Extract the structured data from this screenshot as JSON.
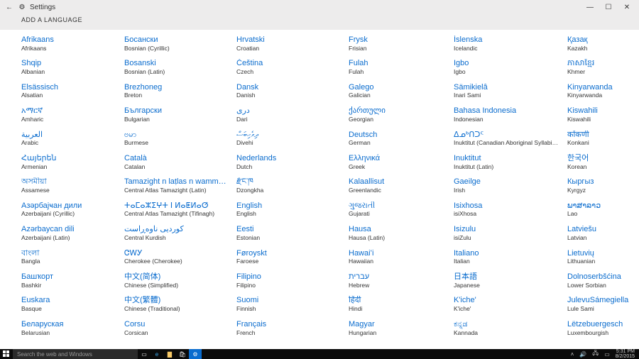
{
  "window": {
    "title": "Settings",
    "back_icon": "←",
    "gear_icon": "⚙",
    "minimize": "—",
    "maximize": "☐",
    "close": "✕"
  },
  "header": "ADD A LANGUAGE",
  "columns": [
    [
      {
        "n": "Afrikaans",
        "e": "Afrikaans"
      },
      {
        "n": "Shqip",
        "e": "Albanian"
      },
      {
        "n": "Elsässisch",
        "e": "Alsatian"
      },
      {
        "n": "አማርኛ",
        "e": "Amharic"
      },
      {
        "n": "العربية",
        "e": "Arabic"
      },
      {
        "n": "Հայերեն",
        "e": "Armenian"
      },
      {
        "n": "অসমীয়া",
        "e": "Assamese"
      },
      {
        "n": "Азәрбајҹан дили",
        "e": "Azerbaijani (Cyrillic)"
      },
      {
        "n": "Azərbaycan dili",
        "e": "Azerbaijani (Latin)"
      },
      {
        "n": "বাংলা",
        "e": "Bangla"
      },
      {
        "n": "Башҡорт",
        "e": "Bashkir"
      },
      {
        "n": "Euskara",
        "e": "Basque"
      },
      {
        "n": "Беларуская",
        "e": "Belarusian"
      }
    ],
    [
      {
        "n": "Босански",
        "e": "Bosnian (Cyrillic)"
      },
      {
        "n": "Bosanski",
        "e": "Bosnian (Latin)"
      },
      {
        "n": "Brezhoneg",
        "e": "Breton"
      },
      {
        "n": "Български",
        "e": "Bulgarian"
      },
      {
        "n": "ဗမာ",
        "e": "Burmese"
      },
      {
        "n": "Català",
        "e": "Catalan"
      },
      {
        "n": "Tamazight n laṭlas n wamm…",
        "e": "Central Atlas Tamazight (Latin)"
      },
      {
        "n": "ⵜⴰⵎⴰⵣⵉⵖⵜ ⵏ ⵍⴰⵟⵍⴰⵚ",
        "e": "Central Atlas Tamazight (Tifinagh)"
      },
      {
        "n": "کوردیی ناوەڕاست",
        "e": "Central Kurdish"
      },
      {
        "n": "ᏣᎳᎩ",
        "e": "Cherokee (Cherokee)"
      },
      {
        "n": "中文(简体)",
        "e": "Chinese (Simplified)"
      },
      {
        "n": "中文(繁體)",
        "e": "Chinese (Traditional)"
      },
      {
        "n": "Corsu",
        "e": "Corsican"
      }
    ],
    [
      {
        "n": "Hrvatski",
        "e": "Croatian"
      },
      {
        "n": "Čeština",
        "e": "Czech"
      },
      {
        "n": "Dansk",
        "e": "Danish"
      },
      {
        "n": "درى",
        "e": "Dari"
      },
      {
        "n": "ދިވެހިބަސް",
        "e": "Divehi"
      },
      {
        "n": "Nederlands",
        "e": "Dutch"
      },
      {
        "n": "རྫོང་ཁ",
        "e": "Dzongkha"
      },
      {
        "n": "English",
        "e": "English"
      },
      {
        "n": "Eesti",
        "e": "Estonian"
      },
      {
        "n": "Føroyskt",
        "e": "Faroese"
      },
      {
        "n": "Filipino",
        "e": "Filipino"
      },
      {
        "n": "Suomi",
        "e": "Finnish"
      },
      {
        "n": "Français",
        "e": "French"
      }
    ],
    [
      {
        "n": "Frysk",
        "e": "Frisian"
      },
      {
        "n": "Fulah",
        "e": "Fulah"
      },
      {
        "n": "Galego",
        "e": "Galician"
      },
      {
        "n": "ქართული",
        "e": "Georgian"
      },
      {
        "n": "Deutsch",
        "e": "German"
      },
      {
        "n": "Ελληνικά",
        "e": "Greek"
      },
      {
        "n": "Kalaallisut",
        "e": "Greenlandic"
      },
      {
        "n": "ગુજરાતી",
        "e": "Gujarati"
      },
      {
        "n": "Hausa",
        "e": "Hausa (Latin)"
      },
      {
        "n": "Hawaiʻi",
        "e": "Hawaiian"
      },
      {
        "n": "עברית",
        "e": "Hebrew"
      },
      {
        "n": "हिंदी",
        "e": "Hindi"
      },
      {
        "n": "Magyar",
        "e": "Hungarian"
      }
    ],
    [
      {
        "n": "Íslenska",
        "e": "Icelandic"
      },
      {
        "n": "Igbo",
        "e": "Igbo"
      },
      {
        "n": "Sämikielâ",
        "e": "Inari Sami"
      },
      {
        "n": "Bahasa Indonesia",
        "e": "Indonesian"
      },
      {
        "n": "ᐃᓄᒃᑎᑐᑦ",
        "e": "Inuktitut (Canadian Aboriginal Syllabics)"
      },
      {
        "n": "Inuktitut",
        "e": "Inuktitut (Latin)"
      },
      {
        "n": "Gaeilge",
        "e": "Irish"
      },
      {
        "n": "Isixhosa",
        "e": "isiXhosa"
      },
      {
        "n": "Isizulu",
        "e": "isiZulu"
      },
      {
        "n": "Italiano",
        "e": "Italian"
      },
      {
        "n": "日本語",
        "e": "Japanese"
      },
      {
        "n": "K'iche'",
        "e": "K'iche'"
      },
      {
        "n": "ಕನ್ನಡ",
        "e": "Kannada"
      }
    ],
    [
      {
        "n": "Қазақ",
        "e": "Kazakh"
      },
      {
        "n": "ភាសាខ្មែរ",
        "e": "Khmer"
      },
      {
        "n": "Kinyarwanda",
        "e": "Kinyarwanda"
      },
      {
        "n": "Kiswahili",
        "e": "Kiswahili"
      },
      {
        "n": "कोंकणी",
        "e": "Konkani"
      },
      {
        "n": "한국어",
        "e": "Korean"
      },
      {
        "n": "Кыргыз",
        "e": "Kyrgyz"
      },
      {
        "n": "ພາສາລາວ",
        "e": "Lao"
      },
      {
        "n": "Latviešu",
        "e": "Latvian"
      },
      {
        "n": "Lietuvių",
        "e": "Lithuanian"
      },
      {
        "n": "Dolnoserbšćina",
        "e": "Lower Sorbian"
      },
      {
        "n": "JulevuSámegiella",
        "e": "Lule Sami"
      },
      {
        "n": "Lëtzebuergesch",
        "e": "Luxembourgish"
      }
    ]
  ],
  "taskbar": {
    "search_placeholder": "Search the web and Windows",
    "time": "5:31 PM",
    "date": "8/2/2015"
  }
}
